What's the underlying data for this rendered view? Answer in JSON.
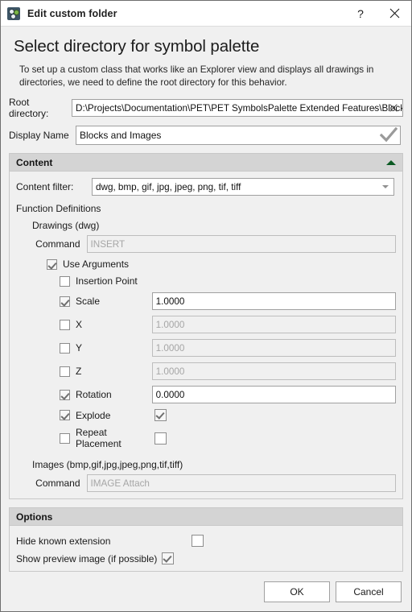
{
  "window": {
    "title": "Edit custom folder",
    "icon": "folder-symbols-icon",
    "help_label": "?",
    "close_label": "×"
  },
  "header": {
    "title": "Select directory for symbol palette",
    "description": "To set up a custom class that works like an Explorer view and displays all drawings in directories, we need to define the root directory for this behavior."
  },
  "root_directory": {
    "label": "Root directory:",
    "value": "D:\\Projects\\Documentation\\PET\\PET SymbolsPalette Extended Features\\Blocks",
    "browse_label": "···",
    "clear_label": "×"
  },
  "display_name": {
    "label": "Display Name",
    "value": "Blocks and Images",
    "valid_icon": "checkmark-icon"
  },
  "content": {
    "title": "Content",
    "collapse_icon": "chevron-up-icon",
    "filter": {
      "label": "Content filter:",
      "value": "dwg, bmp, gif, jpg, jpeg, png, tif, tiff"
    },
    "function_definitions_label": "Function Definitions",
    "drawings": {
      "label": "Drawings (dwg)",
      "command": {
        "label": "Command",
        "value": "INSERT",
        "disabled": true
      },
      "use_arguments": {
        "label": "Use Arguments",
        "checked": true
      },
      "arguments": [
        {
          "label": "Insertion Point",
          "checked": false,
          "type": "none"
        },
        {
          "label": "Scale",
          "checked": true,
          "type": "text",
          "value": "1.0000",
          "disabled": false
        },
        {
          "label": "X",
          "checked": false,
          "type": "text",
          "value": "1.0000",
          "disabled": true
        },
        {
          "label": "Y",
          "checked": false,
          "type": "text",
          "value": "1.0000",
          "disabled": true
        },
        {
          "label": "Z",
          "checked": false,
          "type": "text",
          "value": "1.0000",
          "disabled": true
        },
        {
          "label": "Rotation",
          "checked": true,
          "type": "text",
          "value": "0.0000",
          "disabled": false
        },
        {
          "label": "Explode",
          "checked": true,
          "type": "checkbox",
          "value_checked": true
        },
        {
          "label": "Repeat Placement",
          "checked": false,
          "type": "checkbox",
          "value_checked": false
        }
      ]
    },
    "images": {
      "label": "Images (bmp,gif,jpg,jpeg,png,tif,tiff)",
      "command": {
        "label": "Command",
        "value": "IMAGE Attach",
        "disabled": true
      }
    }
  },
  "options": {
    "title": "Options",
    "items": [
      {
        "label": "Hide known extension",
        "checked": false
      },
      {
        "label": "Show preview image (if possible)",
        "checked": true
      }
    ]
  },
  "footer": {
    "ok_label": "OK",
    "cancel_label": "Cancel"
  },
  "colors": {
    "accent_green": "#0b5a23",
    "titlebar_bg": "#ffffff",
    "body_bg": "#f0f0f0",
    "group_header_bg": "#d4d4d4"
  }
}
